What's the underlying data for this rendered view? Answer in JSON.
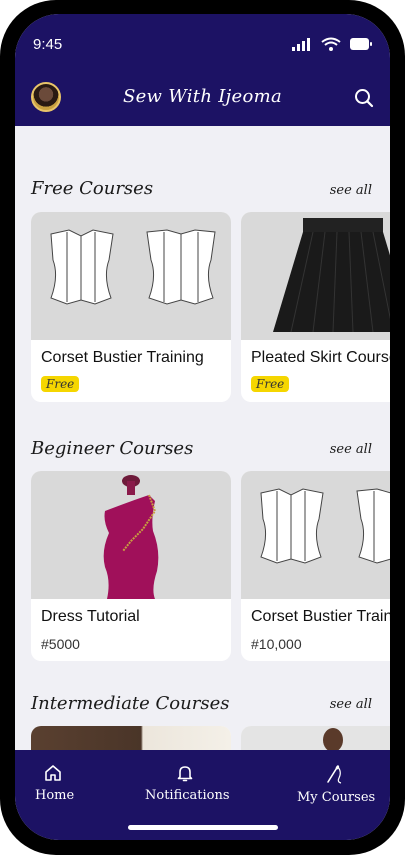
{
  "status_bar": {
    "time": "9:45"
  },
  "header": {
    "title": "Sew With Ijeoma"
  },
  "sections": [
    {
      "title": "Free Courses",
      "see_all": "see all",
      "cards": [
        {
          "title": "Corset Bustier Training",
          "tag": "Free"
        },
        {
          "title": "Pleated Skirt Course",
          "tag": "Free"
        }
      ]
    },
    {
      "title": "Begineer Courses",
      "see_all": "see all",
      "cards": [
        {
          "title": "Dress Tutorial",
          "price": "#5000"
        },
        {
          "title": "Corset Bustier Training",
          "price": "#10,000"
        }
      ]
    },
    {
      "title": "Intermediate Courses",
      "see_all": "see all"
    }
  ],
  "nav": {
    "home": "Home",
    "notifications": "Notifications",
    "my_courses": "My Courses"
  },
  "colors": {
    "brand": "#1c1264",
    "badge": "#f5d600",
    "background": "#f0f0f5"
  }
}
